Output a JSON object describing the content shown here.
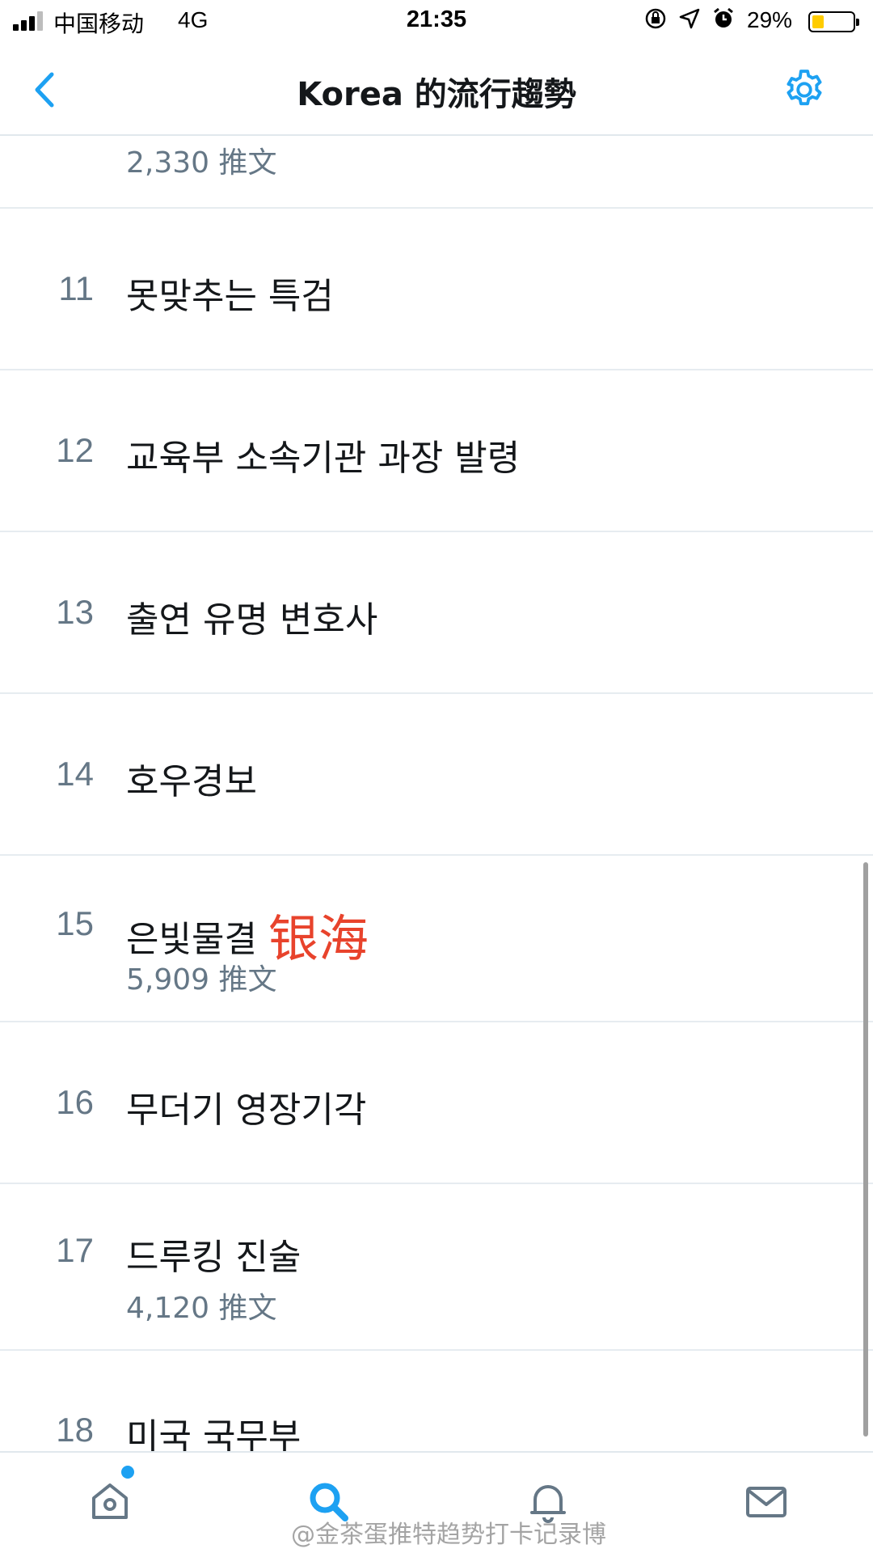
{
  "status_bar": {
    "carrier": "中国移动",
    "network": "4G",
    "time": "21:35",
    "icons": [
      "orientation-lock-icon",
      "location-icon",
      "alarm-icon"
    ],
    "battery_percent": "29%",
    "battery_level": 0.29,
    "battery_color": "#ffcc00"
  },
  "nav": {
    "title": "Korea 的流行趨勢",
    "accent_color": "#1da1f2"
  },
  "trends": {
    "partial_count": "2,330 推文",
    "items": [
      {
        "rank": "11",
        "name": "못맞추는 특검",
        "count": ""
      },
      {
        "rank": "12",
        "name": "교육부 소속기관 과장 발령",
        "count": ""
      },
      {
        "rank": "13",
        "name": "출연 유명 변호사",
        "count": ""
      },
      {
        "rank": "14",
        "name": "호우경보",
        "count": ""
      },
      {
        "rank": "15",
        "name": "은빛물결",
        "annotation": "银海",
        "count": "5,909 推文"
      },
      {
        "rank": "16",
        "name": "무더기 영장기각",
        "count": ""
      },
      {
        "rank": "17",
        "name": "드루킹 진술",
        "count": "4,120 推文"
      },
      {
        "rank": "18",
        "name": "미국 국무부",
        "count": ""
      }
    ]
  },
  "tab_bar": {
    "tabs": [
      "home-icon",
      "search-icon",
      "notifications-icon",
      "messages-icon"
    ],
    "watermark": "@金茶蛋推特趋势打卡记录博"
  }
}
